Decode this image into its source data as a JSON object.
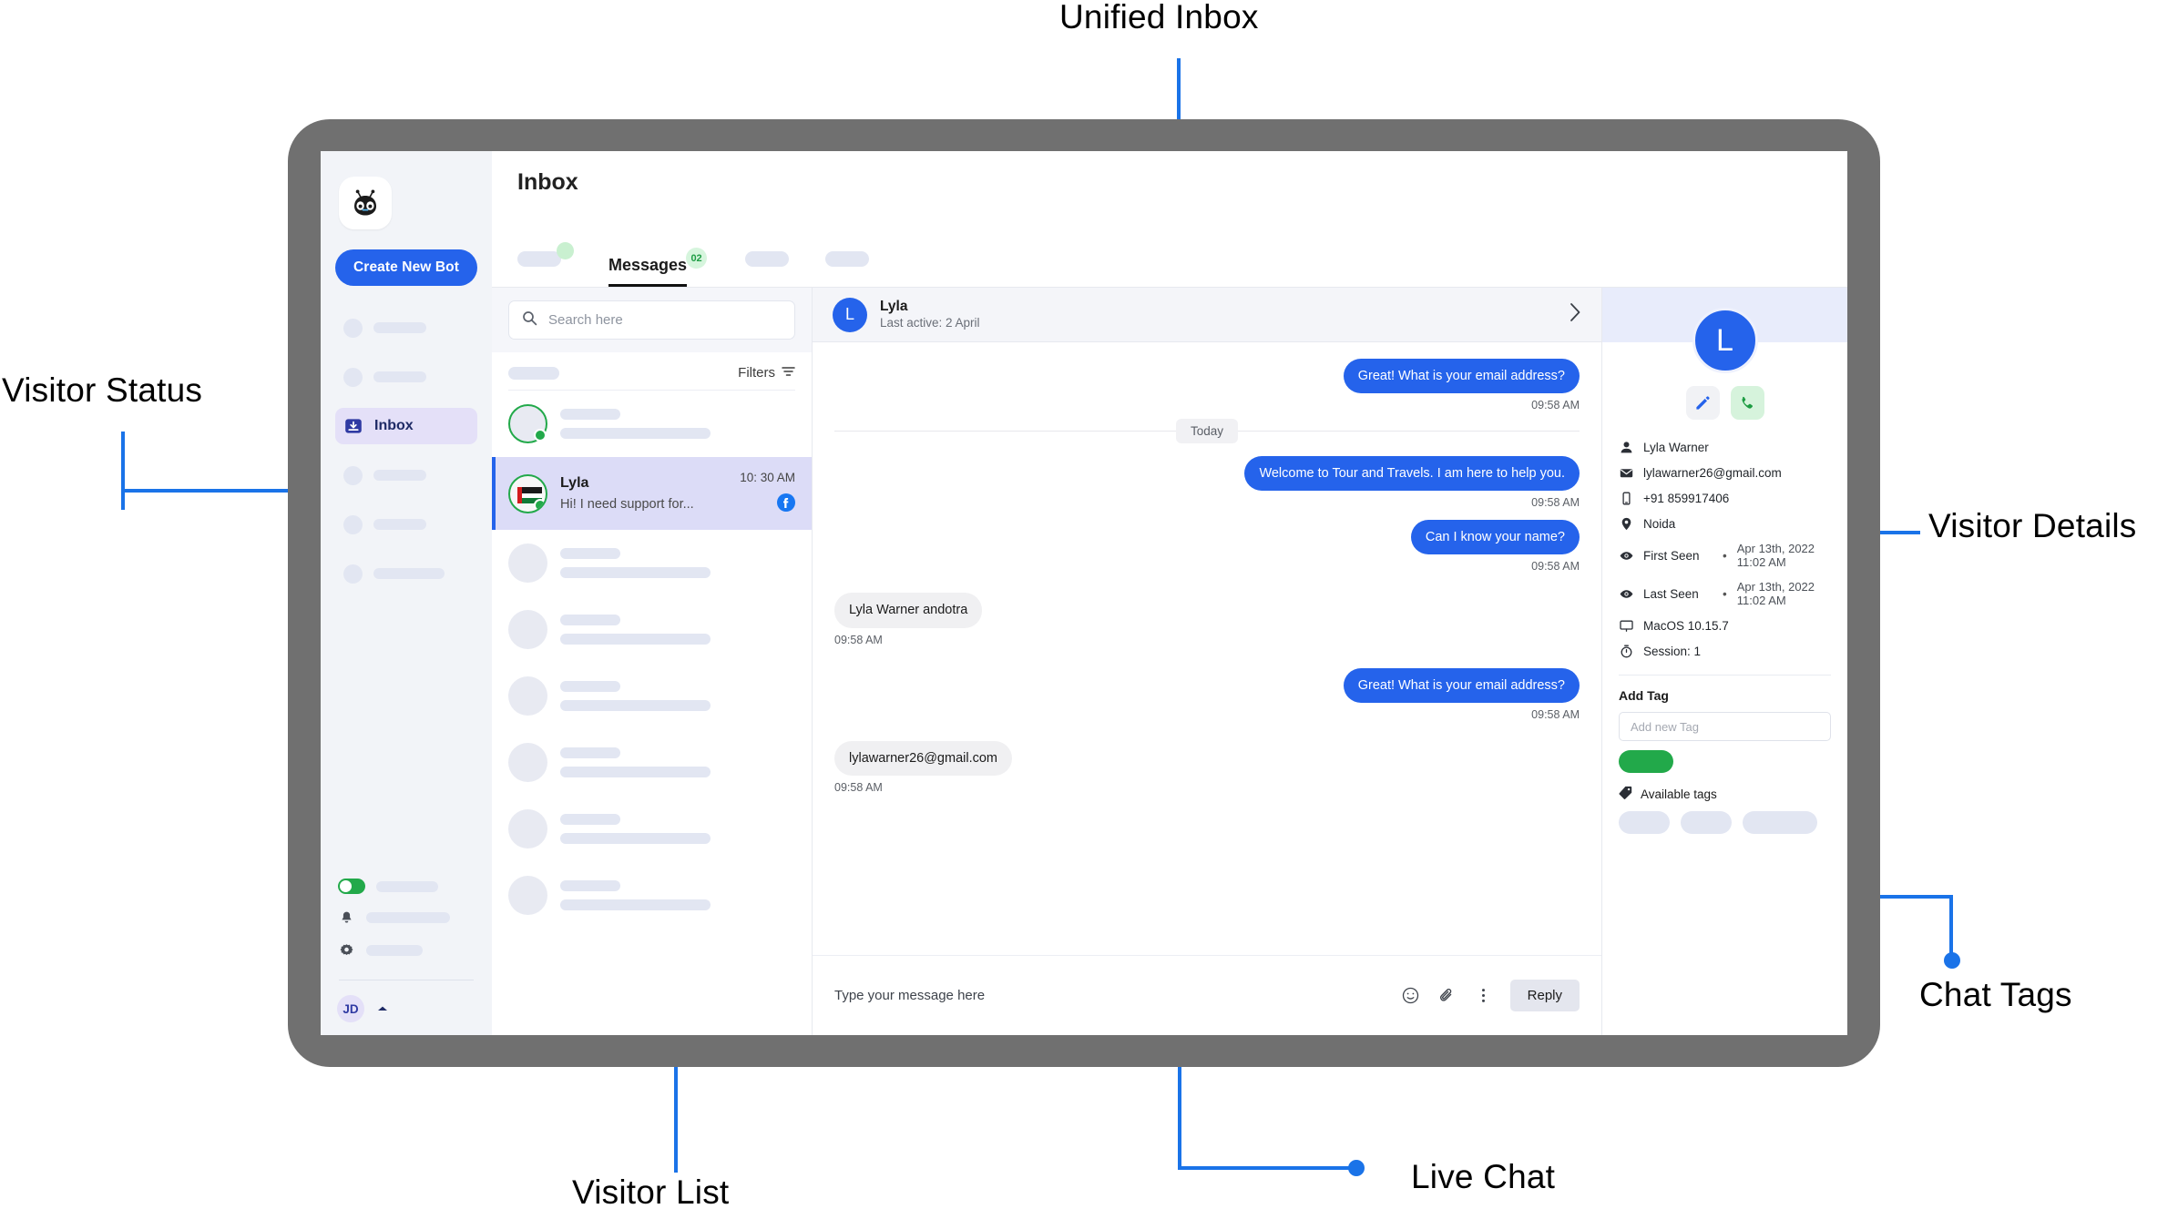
{
  "annotations": [
    {
      "id": "unified-inbox",
      "label": "Unified Inbox"
    },
    {
      "id": "visitor-status",
      "label": "Visitor Status"
    },
    {
      "id": "visitor-details",
      "label": "Visitor Details"
    },
    {
      "id": "chat-tags",
      "label": "Chat Tags"
    },
    {
      "id": "visitor-list",
      "label": "Visitor List"
    },
    {
      "id": "live-chat",
      "label": "Live Chat"
    }
  ],
  "accent_color": "#2563eb",
  "annotation_color": "#1a73e8",
  "frame_color": "#707070",
  "rail": {
    "logo_icon": "bot-logo-icon",
    "create_button": "Create New Bot",
    "items": [
      {
        "type": "skeleton",
        "icon": "skeleton-circle-icon",
        "label": ""
      },
      {
        "type": "skeleton",
        "icon": "skeleton-circle-icon",
        "label": ""
      },
      {
        "type": "active",
        "icon": "inbox-icon",
        "label": "Inbox"
      },
      {
        "type": "skeleton",
        "icon": "skeleton-circle-icon",
        "label": ""
      },
      {
        "type": "skeleton",
        "icon": "skeleton-circle-icon",
        "label": ""
      },
      {
        "type": "skeleton",
        "icon": "skeleton-circle-icon",
        "label": ""
      }
    ],
    "toggle_on": true,
    "bell_icon": "bell-icon",
    "gear_icon": "gear-icon",
    "user_initials": "JD"
  },
  "header": {
    "title": "Inbox"
  },
  "tabs": [
    {
      "label": "",
      "skeleton": true,
      "dot": true,
      "active": false
    },
    {
      "label": "Messages",
      "skeleton": false,
      "badge": "02",
      "active": true
    },
    {
      "label": "",
      "skeleton": true,
      "active": false
    },
    {
      "label": "",
      "skeleton": true,
      "active": false
    }
  ],
  "visitor_list": {
    "search_placeholder": "Search here",
    "search_icon": "search-icon",
    "filters_label": "Filters",
    "filters_icon": "filter-icon",
    "rows": [
      {
        "skeleton": true,
        "online": true,
        "name": "",
        "preview": "",
        "time": ""
      },
      {
        "skeleton": false,
        "online": true,
        "selected": true,
        "name": "Lyla",
        "preview": "Hi! I need support for...",
        "time": "10: 30 AM",
        "channel_icon": "facebook-icon",
        "avatar": "uae-flag-icon"
      },
      {
        "skeleton": true,
        "online": false
      },
      {
        "skeleton": true,
        "online": false
      },
      {
        "skeleton": true,
        "online": false
      },
      {
        "skeleton": true,
        "online": false
      },
      {
        "skeleton": true,
        "online": false
      },
      {
        "skeleton": true,
        "online": false
      }
    ]
  },
  "chat": {
    "header": {
      "avatar_initial": "L",
      "name": "Lyla",
      "subtitle": "Last active: 2 April",
      "expand_icon": "chevron-right-icon"
    },
    "day_separator": "Today",
    "messages": [
      {
        "dir": "out",
        "text": "Great! What is your email address?",
        "time": "09:58 AM"
      },
      {
        "separator": "Today"
      },
      {
        "dir": "out",
        "text": "Welcome to Tour and Travels. I am here to help you.",
        "time": "09:58 AM"
      },
      {
        "dir": "out",
        "text": "Can I know your name?",
        "time": "09:58 AM"
      },
      {
        "dir": "in",
        "text": "Lyla Warner andotra",
        "time": "09:58 AM"
      },
      {
        "dir": "out",
        "text": "Great! What is your email address?",
        "time": "09:58 AM"
      },
      {
        "dir": "in",
        "text": "lylawarner26@gmail.com",
        "time": "09:58 AM"
      }
    ],
    "composer": {
      "placeholder": "Type your message here",
      "emoji_icon": "emoji-icon",
      "attach_icon": "paperclip-icon",
      "more_icon": "kebab-menu-icon",
      "reply_label": "Reply"
    }
  },
  "details": {
    "avatar_initial": "L",
    "edit_icon": "pencil-icon",
    "call_icon": "phone-icon",
    "fields": [
      {
        "icon": "person-icon",
        "label": "Lyla Warner",
        "value": ""
      },
      {
        "icon": "mail-icon",
        "label": "lylawarner26@gmail.com",
        "value": ""
      },
      {
        "icon": "mobile-icon",
        "label": "+91 859917406",
        "value": ""
      },
      {
        "icon": "location-pin-icon",
        "label": "Noida",
        "value": ""
      },
      {
        "icon": "eye-icon",
        "label": "First Seen",
        "sep": "•",
        "value": "Apr 13th, 2022 11:02 AM"
      },
      {
        "icon": "eye-icon",
        "label": "Last Seen",
        "sep": "•",
        "value": "Apr 13th, 2022 11:02 AM"
      },
      {
        "icon": "monitor-icon",
        "label": "MacOS 10.15.7",
        "value": ""
      },
      {
        "icon": "timer-icon",
        "label": "Session: 1",
        "value": ""
      }
    ],
    "tags": {
      "heading": "Add Tag",
      "input_placeholder": "Add new Tag",
      "active_tag_color": "#22a94a",
      "available_label": "Available tags",
      "available_icon": "tag-icon",
      "available_chips": [
        56,
        56,
        82
      ]
    }
  }
}
